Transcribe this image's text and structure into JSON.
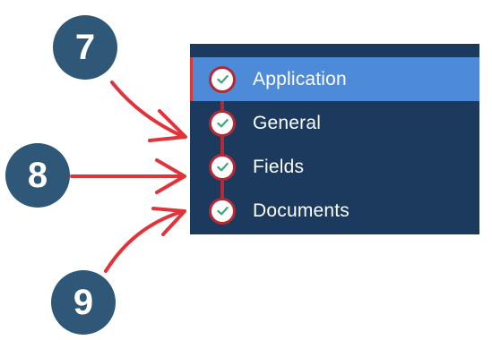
{
  "callouts": [
    {
      "number": "7"
    },
    {
      "number": "8"
    },
    {
      "number": "9"
    }
  ],
  "steps": [
    {
      "label": "Application",
      "active": true,
      "icon": "check-icon"
    },
    {
      "label": "General",
      "active": false,
      "icon": "check-icon"
    },
    {
      "label": "Fields",
      "active": false,
      "icon": "check-icon"
    },
    {
      "label": "Documents",
      "active": false,
      "icon": "check-icon"
    }
  ],
  "colors": {
    "callout": "#2f5878",
    "arrow": "#e0343a",
    "panel": "#1b3a5d",
    "active_step": "#4d8bd8",
    "connector": "#b12a36",
    "check": "#3aa87a"
  }
}
